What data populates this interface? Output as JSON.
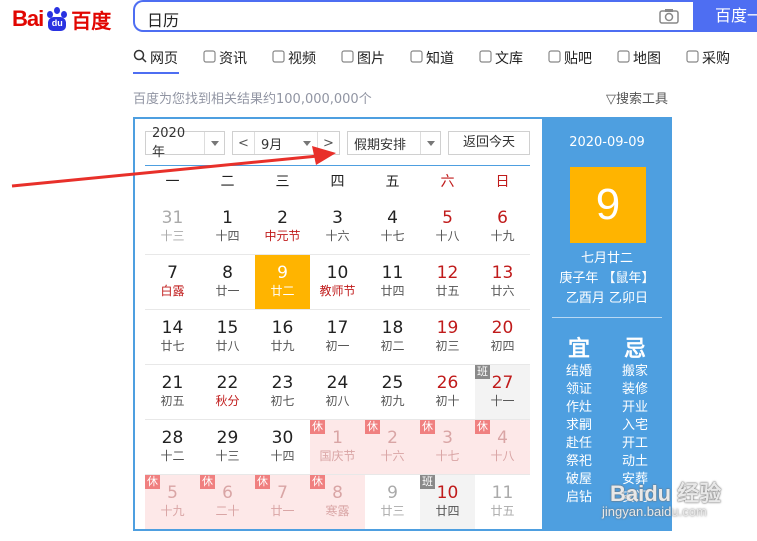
{
  "header": {
    "logo_bai": "Bai",
    "logo_du": "du",
    "logo_cn": "百度",
    "query": "日历",
    "search_button": "百度一下"
  },
  "tabs": [
    {
      "label": "网页",
      "icon": "search-icon"
    },
    {
      "label": "资讯",
      "icon": "news-icon"
    },
    {
      "label": "视频",
      "icon": "video-icon"
    },
    {
      "label": "图片",
      "icon": "image-icon"
    },
    {
      "label": "知道",
      "icon": "question-icon"
    },
    {
      "label": "文库",
      "icon": "doc-icon"
    },
    {
      "label": "贴吧",
      "icon": "tieba-icon"
    },
    {
      "label": "地图",
      "icon": "map-icon"
    },
    {
      "label": "采购",
      "icon": "cart-icon"
    }
  ],
  "result_count": "百度为您找到相关结果约100,000,000个",
  "search_tools": "搜索工具",
  "calendar": {
    "year": "2020年",
    "month": "9月",
    "holiday_select": "假期安排",
    "today_button": "返回今天",
    "weekdays": [
      "一",
      "二",
      "三",
      "四",
      "五",
      "六",
      "日"
    ],
    "rows": [
      [
        {
          "d": "31",
          "l": "十三",
          "other": true
        },
        {
          "d": "1",
          "l": "十四"
        },
        {
          "d": "2",
          "l": "中元节",
          "red": true
        },
        {
          "d": "3",
          "l": "十六"
        },
        {
          "d": "4",
          "l": "十七"
        },
        {
          "d": "5",
          "l": "十八",
          "weekend": true
        },
        {
          "d": "6",
          "l": "十九",
          "weekend": true
        }
      ],
      [
        {
          "d": "7",
          "l": "白露",
          "red": true
        },
        {
          "d": "8",
          "l": "廿一"
        },
        {
          "d": "9",
          "l": "廿二",
          "selected": true
        },
        {
          "d": "10",
          "l": "教师节",
          "red": true
        },
        {
          "d": "11",
          "l": "廿四"
        },
        {
          "d": "12",
          "l": "廿五",
          "weekend": true
        },
        {
          "d": "13",
          "l": "廿六",
          "weekend": true
        }
      ],
      [
        {
          "d": "14",
          "l": "廿七"
        },
        {
          "d": "15",
          "l": "廿八"
        },
        {
          "d": "16",
          "l": "廿九"
        },
        {
          "d": "17",
          "l": "初一"
        },
        {
          "d": "18",
          "l": "初二"
        },
        {
          "d": "19",
          "l": "初三",
          "weekend": true
        },
        {
          "d": "20",
          "l": "初四",
          "weekend": true
        }
      ],
      [
        {
          "d": "21",
          "l": "初五"
        },
        {
          "d": "22",
          "l": "秋分",
          "red": true
        },
        {
          "d": "23",
          "l": "初七"
        },
        {
          "d": "24",
          "l": "初八"
        },
        {
          "d": "25",
          "l": "初九"
        },
        {
          "d": "26",
          "l": "初十",
          "weekend": true
        },
        {
          "d": "27",
          "l": "十一",
          "work": true,
          "tag": "班"
        }
      ],
      [
        {
          "d": "28",
          "l": "十二"
        },
        {
          "d": "29",
          "l": "十三"
        },
        {
          "d": "30",
          "l": "十四"
        },
        {
          "d": "1",
          "l": "国庆节",
          "other": true,
          "rest": true,
          "tag": "休"
        },
        {
          "d": "2",
          "l": "十六",
          "other": true,
          "rest": true,
          "tag": "休"
        },
        {
          "d": "3",
          "l": "十七",
          "other": true,
          "rest": true,
          "tag": "休"
        },
        {
          "d": "4",
          "l": "十八",
          "other": true,
          "rest": true,
          "tag": "休"
        }
      ],
      [
        {
          "d": "5",
          "l": "十九",
          "other": true,
          "rest": true,
          "tag": "休"
        },
        {
          "d": "6",
          "l": "二十",
          "other": true,
          "rest": true,
          "tag": "休"
        },
        {
          "d": "7",
          "l": "廿一",
          "other": true,
          "rest": true,
          "tag": "休"
        },
        {
          "d": "8",
          "l": "寒露",
          "other": true,
          "rest": true,
          "tag": "休"
        },
        {
          "d": "9",
          "l": "廿三",
          "other": true
        },
        {
          "d": "10",
          "l": "廿四",
          "work": true,
          "tag": "班"
        },
        {
          "d": "11",
          "l": "廿五",
          "other": true
        }
      ]
    ]
  },
  "side": {
    "date": "2020-09-09",
    "day": "9",
    "lunar": "七月廿二",
    "ganzhi_year": "庚子年 【鼠年】",
    "ganzhi_monthday": "乙酉月 乙卯日",
    "yi": "宜",
    "ji": "忌",
    "yi_list": [
      "结婚",
      "领证",
      "作灶",
      "求嗣",
      "赴任",
      "祭祀",
      "破屋",
      "启钻"
    ],
    "ji_list": [
      "搬家",
      "装修",
      "开业",
      "入宅",
      "开工",
      "动土",
      "安葬",
      "安门"
    ]
  },
  "watermark": {
    "text": "Baidu 经验",
    "url": "jingyan.baidu.com"
  },
  "colors": {
    "accent": "#4e6ef2",
    "calendar_blue": "#4e9fe0",
    "selected": "#ffb400",
    "weekend_red": "#c01b1b",
    "arrow_red": "#e8302a"
  }
}
